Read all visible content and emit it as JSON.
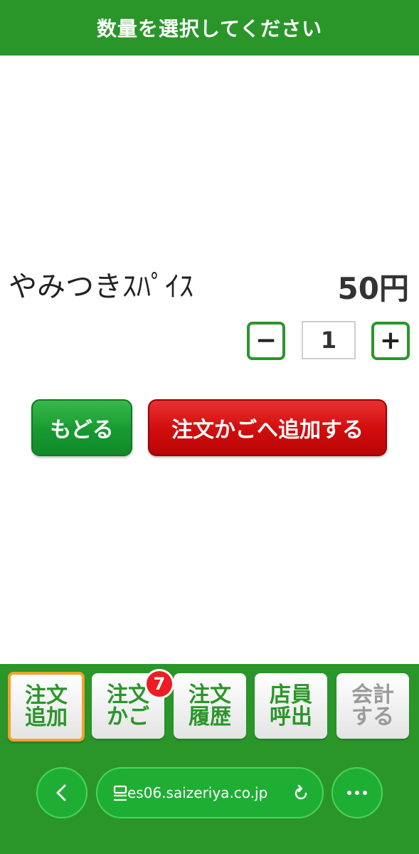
{
  "header": {
    "title": "数量を選択してください"
  },
  "item": {
    "name": "やみつきｽﾊﾟｲｽ",
    "price": "50円"
  },
  "quantity": {
    "minus_label": "−",
    "value": "1",
    "plus_label": "+"
  },
  "actions": {
    "back_label": "もどる",
    "add_label": "注文かごへ追加する"
  },
  "nav": {
    "items": [
      {
        "line1": "注文",
        "line2": "追加"
      },
      {
        "line1": "注文",
        "line2": "かご"
      },
      {
        "line1": "注文",
        "line2": "履歴"
      },
      {
        "line1": "店員",
        "line2": "呼出"
      },
      {
        "line1": "会計",
        "line2": "する"
      }
    ],
    "cart_badge": "7"
  },
  "browser": {
    "url": "es06.saizeriya.co.jp",
    "back_icon": "chevron-left-icon",
    "more_icon": "more-horizontal-icon"
  },
  "colors": {
    "brand_green": "#2a962a",
    "add_red": "#d10c0c",
    "active_outline": "#f3a22a",
    "badge_red": "#ee1c24"
  }
}
